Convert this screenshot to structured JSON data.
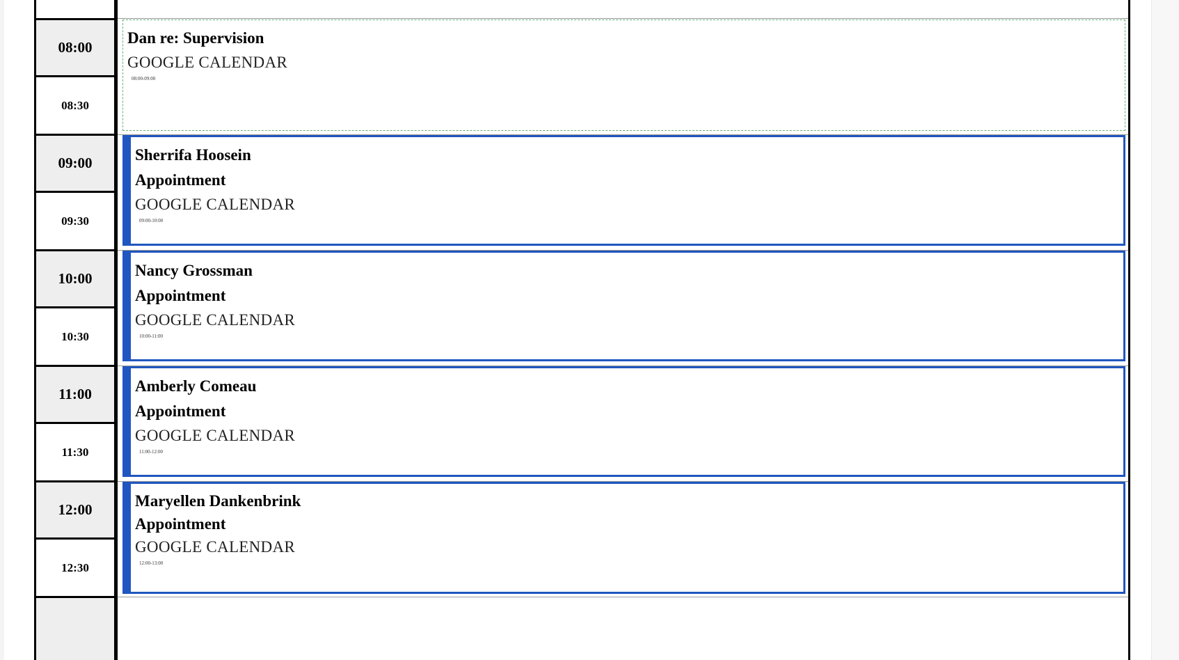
{
  "time_slots": [
    {
      "label": "08:00",
      "type": "hour"
    },
    {
      "label": "08:30",
      "type": "half"
    },
    {
      "label": "09:00",
      "type": "hour"
    },
    {
      "label": "09:30",
      "type": "half"
    },
    {
      "label": "10:00",
      "type": "hour"
    },
    {
      "label": "10:30",
      "type": "half"
    },
    {
      "label": "11:00",
      "type": "hour"
    },
    {
      "label": "11:30",
      "type": "half"
    },
    {
      "label": "12:00",
      "type": "hour"
    },
    {
      "label": "12:30",
      "type": "half"
    }
  ],
  "events": [
    {
      "title": "Dan re: Supervision",
      "source": "GOOGLE CALENDAR",
      "time": "08:00-09:00",
      "style": "dashed",
      "border_color": "#66b07a"
    },
    {
      "title": "Sherrifa Hoosein Appointment",
      "source": "GOOGLE CALENDAR",
      "time": "09:00-10:00",
      "style": "solid",
      "border_color": "#1f56c0"
    },
    {
      "title": "Nancy Grossman Appointment",
      "source": "GOOGLE CALENDAR",
      "time": "10:00-11:00",
      "style": "solid",
      "border_color": "#1f56c0"
    },
    {
      "title": "Amberly Comeau Appointment",
      "source": "GOOGLE CALENDAR",
      "time": "11:00-12:00",
      "style": "solid",
      "border_color": "#1f56c0"
    },
    {
      "title": "Maryellen Dankenbrink Appointment",
      "source": "GOOGLE CALENDAR",
      "time": "12:00-13:00",
      "style": "solid",
      "border_color": "#1f56c0"
    }
  ]
}
